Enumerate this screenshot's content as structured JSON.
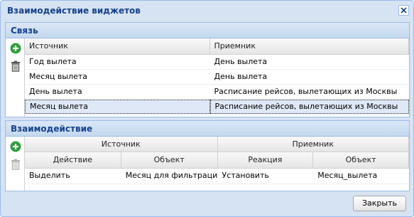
{
  "dialog": {
    "title": "Взаимодействие виджетов",
    "close_icon": "close-icon"
  },
  "links_panel": {
    "title": "Связь",
    "add_icon": "plus-circle-icon",
    "delete_icon": "trash-icon",
    "columns": [
      "Источник",
      "Приемник"
    ],
    "rows": [
      [
        "Год вылета",
        "День вылета"
      ],
      [
        "Месяц вылета",
        "День вылета"
      ],
      [
        "День вылета",
        "Расписание рейсов, вылетающих из Москвы"
      ],
      [
        "Месяц вылета",
        "Расписание рейсов, вылетающих из Москвы"
      ]
    ],
    "selected_row": 3
  },
  "interaction_panel": {
    "title": "Взаимодействие",
    "add_icon": "plus-circle-icon",
    "delete_icon": "trash-icon",
    "group_columns": [
      "Источник",
      "Приемник"
    ],
    "columns": [
      "Действие",
      "Объект",
      "Реакция",
      "Объект"
    ],
    "rows": [
      [
        "Выделить",
        "Месяц для фильтрации",
        "Установить",
        "Месяц_вылета"
      ]
    ]
  },
  "footer": {
    "close_label": "Закрыть"
  },
  "colors": {
    "title": "#15428b",
    "border": "#99bbe8",
    "background": "#d6e3f2",
    "add_icon": "#2e9e3a",
    "selected_row": "#dfe8f6"
  }
}
